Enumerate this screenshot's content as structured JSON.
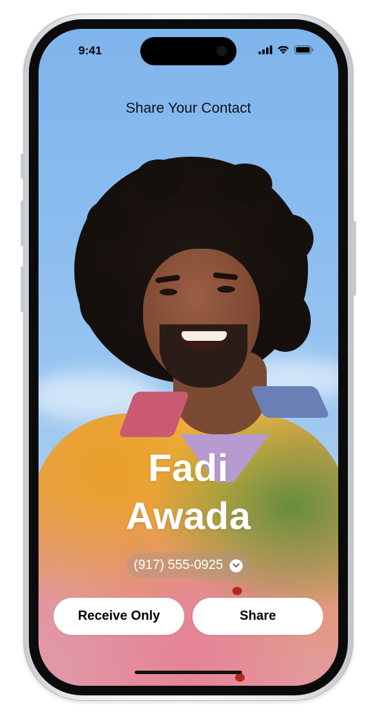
{
  "status_bar": {
    "time": "9:41",
    "icons": [
      "cellular-signal-icon",
      "wifi-icon",
      "battery-icon"
    ]
  },
  "header": {
    "title": "Share Your Contact"
  },
  "contact": {
    "first_name": "Fadi",
    "last_name": "Awada",
    "phone": "(917) 555-0925",
    "phone_menu_icon": "chevron-down-icon"
  },
  "actions": {
    "receive_only_label": "Receive Only",
    "share_label": "Share"
  },
  "colors": {
    "sky": "#8bbcef",
    "button_bg": "#ffffff",
    "name_text": "#ffffff"
  }
}
